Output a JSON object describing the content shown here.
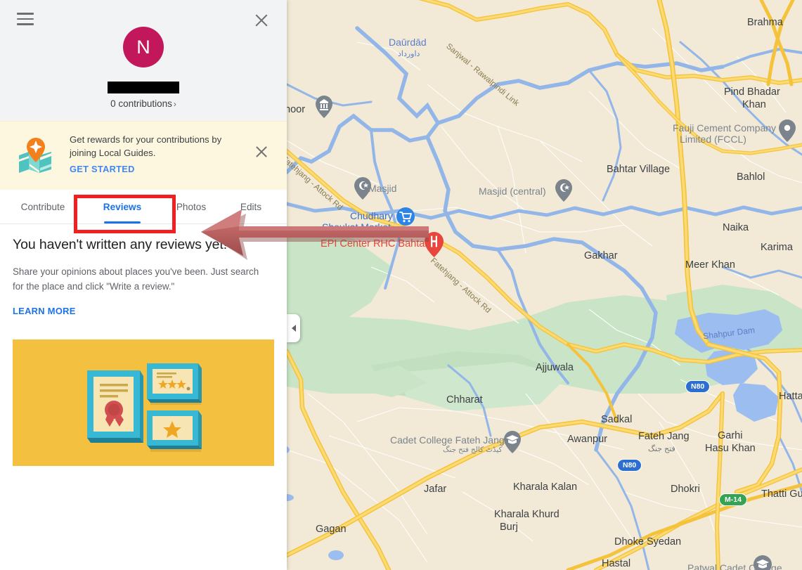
{
  "panel": {
    "menu_icon": "hamburger-menu-icon",
    "close_icon": "close-icon",
    "avatar": {
      "initial": "N",
      "color": "#c2185b"
    },
    "name_redacted": "",
    "contributions": "0 contributions",
    "contributions_chevron": "›"
  },
  "banner": {
    "icon": "local-guides-map-pin-icon",
    "message": "Get rewards for your contributions by joining Local Guides.",
    "cta": "GET STARTED",
    "close_icon": "close-icon",
    "bg_color": "#fef7e0"
  },
  "tabs": [
    {
      "label": "Contribute",
      "active": false
    },
    {
      "label": "Reviews",
      "active": true
    },
    {
      "label": "Photos",
      "active": false
    },
    {
      "label": "Edits",
      "active": false
    }
  ],
  "accent_color": "#1a73e8",
  "empty_state": {
    "heading": "You haven't written any reviews yet!",
    "body": "Share your opinions about places you've been. Just search for the place and click \"Write a review.\"",
    "link": "LEARN MORE",
    "illustration": "framed-certificate-and-star-reviews-illustration"
  },
  "annotation": {
    "box_color": "#f21f1f",
    "arrow_color": "#c06464",
    "target_tab": "Reviews"
  },
  "map": {
    "collapse_button_icon": "chevron-left-icon",
    "place_labels": [
      {
        "text": "Daūrdād",
        "type": "water"
      },
      {
        "text": "داورداد",
        "type": "urdu"
      },
      {
        "text": "Brahma",
        "type": "city"
      },
      {
        "text": "Pind Bhadar",
        "type": "city"
      },
      {
        "text": "Khan",
        "type": "city"
      },
      {
        "text": "Fauji Cement Company",
        "type": "poi"
      },
      {
        "text": "Limited (FCCL)",
        "type": "poi"
      },
      {
        "text": "Bahtar Village",
        "type": "city"
      },
      {
        "text": "Bahlol",
        "type": "city"
      },
      {
        "text": "hoor",
        "type": "city"
      },
      {
        "text": "Masjid",
        "type": "poi"
      },
      {
        "text": "Masjid (central)",
        "type": "poi"
      },
      {
        "text": "Chudhary",
        "type": "poi-b"
      },
      {
        "text": "Shoukat Market",
        "type": "poi-b"
      },
      {
        "text": "EPI Center RHC Bahtar",
        "type": "poi-r"
      },
      {
        "text": "Naika",
        "type": "city"
      },
      {
        "text": "Karima",
        "type": "city"
      },
      {
        "text": "Gakhar",
        "type": "city"
      },
      {
        "text": "Meer Khan",
        "type": "city"
      },
      {
        "text": "Shahpur Dam",
        "type": "water"
      },
      {
        "text": "Ajjuwala",
        "type": "city"
      },
      {
        "text": "Chharat",
        "type": "city"
      },
      {
        "text": "Garhi",
        "type": "city"
      },
      {
        "text": "Hasu Khan",
        "type": "city"
      },
      {
        "text": "Hattar",
        "type": "city"
      },
      {
        "text": "Sadkal",
        "type": "city"
      },
      {
        "text": "Awanpur",
        "type": "city"
      },
      {
        "text": "Fateh Jang",
        "type": "city"
      },
      {
        "text": "فتح جنگ",
        "type": "urdu-d"
      },
      {
        "text": "Cadet College Fateh Jang",
        "type": "poi"
      },
      {
        "text": "کیڈٹ کالج فتح جنگ",
        "type": "poi"
      },
      {
        "text": "Jafar",
        "type": "city"
      },
      {
        "text": "Kharala Kalan",
        "type": "city"
      },
      {
        "text": "Kharala Khurd",
        "type": "city"
      },
      {
        "text": "Burj",
        "type": "city"
      },
      {
        "text": "Dhokri",
        "type": "city"
      },
      {
        "text": "Thatti Gujrat",
        "type": "city"
      },
      {
        "text": "Gagan",
        "type": "city"
      },
      {
        "text": "Dhoke Syedan",
        "type": "city"
      },
      {
        "text": "Hastal",
        "type": "city"
      },
      {
        "text": "Patwal Cadet College",
        "type": "poi"
      }
    ],
    "road_labels": [
      "Sanjwal - Rawalpindi Link",
      "Fatehjang - Attock Rd",
      "Fatehjang - Attock Rd"
    ],
    "route_shields": [
      "N80",
      "N80",
      "M-14"
    ],
    "markers": [
      {
        "name": "mosque-marker",
        "label": "Masjid"
      },
      {
        "name": "mosque-marker",
        "label": "Masjid (central)"
      },
      {
        "name": "shopping-cart-marker",
        "label": "Chudhary Shoukat Market"
      },
      {
        "name": "hospital-marker",
        "label": "EPI Center RHC Bahtar"
      },
      {
        "name": "generic-marker",
        "label": "Fauji Cement Company Limited (FCCL)"
      },
      {
        "name": "museum-marker",
        "label": "hoor"
      },
      {
        "name": "school-marker",
        "label": "Cadet College Fateh Jang"
      },
      {
        "name": "school-marker",
        "label": "Patwal Cadet College"
      }
    ]
  }
}
